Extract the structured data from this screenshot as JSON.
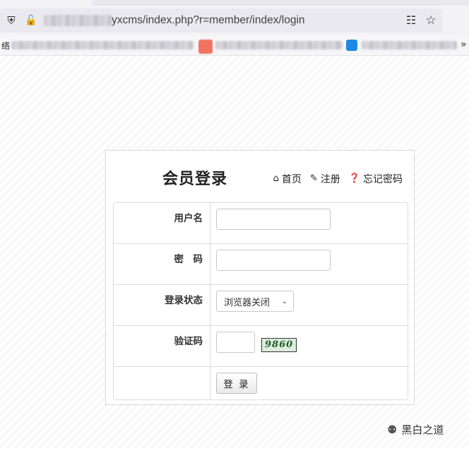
{
  "browser": {
    "url_visible": "yxcms/index.php?r=member/index/login",
    "bookmark_first_char": "络",
    "more_label": "»"
  },
  "icons": {
    "shield": "shield-icon",
    "lock": "lock-off-icon",
    "qr": "qr-code-icon",
    "star": "bookmark-star-icon",
    "home": "home-icon",
    "edit": "edit-icon",
    "question": "question-icon",
    "wechat": "wechat-icon"
  },
  "login": {
    "title": "会员登录",
    "links": {
      "home": "首页",
      "register": "注册",
      "forgot": "忘记密码"
    },
    "fields": {
      "username_label": "用户名",
      "password_label": "密　码",
      "status_label": "登录状态",
      "status_selected": "浏览器关闭",
      "captcha_label": "验证码",
      "captcha_value": "9860"
    },
    "submit_label": "登 录"
  },
  "watermark": "黑白之道"
}
